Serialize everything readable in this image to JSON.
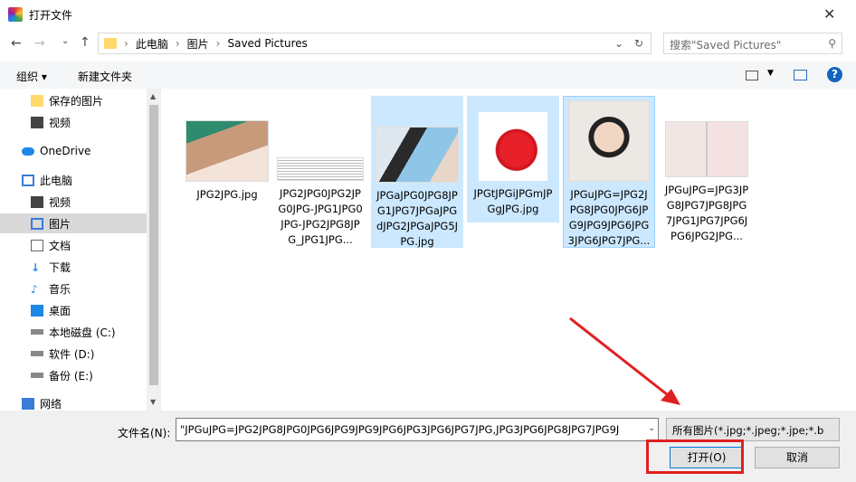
{
  "window": {
    "title": "打开文件"
  },
  "nav": {
    "breadcrumb": [
      "此电脑",
      "图片",
      "Saved Pictures"
    ],
    "search_placeholder": "搜索\"Saved Pictures\""
  },
  "toolbar": {
    "organize": "组织 ▾",
    "new_folder": "新建文件夹"
  },
  "sidebar": {
    "items": [
      {
        "label": "保存的图片",
        "icon": "folder-icon"
      },
      {
        "label": "视频",
        "icon": "video-icon"
      },
      {
        "label": "OneDrive",
        "icon": "cloud-icon"
      },
      {
        "label": "此电脑",
        "icon": "computer-icon"
      },
      {
        "label": "视频",
        "icon": "video-icon"
      },
      {
        "label": "图片",
        "icon": "pictures-icon",
        "selected": true
      },
      {
        "label": "文档",
        "icon": "document-icon"
      },
      {
        "label": "下载",
        "icon": "download-icon"
      },
      {
        "label": "音乐",
        "icon": "music-icon"
      },
      {
        "label": "桌面",
        "icon": "desktop-icon"
      },
      {
        "label": "本地磁盘 (C:)",
        "icon": "drive-icon"
      },
      {
        "label": "软件 (D:)",
        "icon": "drive-icon"
      },
      {
        "label": "备份 (E:)",
        "icon": "drive-icon"
      },
      {
        "label": "网络",
        "icon": "network-icon"
      }
    ]
  },
  "files": [
    {
      "name": "JPG2JPG.jpg",
      "selected": false
    },
    {
      "name": "JPG2JPG0JPG2JPG0JPG-JPG1JPG0JPG-JPG2JPG8JPG_JPG1JPG...",
      "selected": false
    },
    {
      "name": "JPGaJPG0JPG8JPG1JPG7JPGaJPGdJPG2JPGaJPG5JPG.jpg",
      "selected": true
    },
    {
      "name": "JPGtJPGiJPGmJPGgJPG.jpg",
      "selected": true
    },
    {
      "name": "JPGuJPG=JPG2JPG8JPG0JPG6JPG9JPG9JPG6JPG3JPG6JPG7JPG...",
      "selected": true
    },
    {
      "name": "JPGuJPG=JPG3JPG8JPG7JPG8JPG7JPG1JPG7JPG6JPG6JPG2JPG...",
      "selected": false
    }
  ],
  "bottom": {
    "filename_label": "文件名(N):",
    "filename_value": "\"JPGuJPG=JPG2JPG8JPG0JPG6JPG9JPG9JPG6JPG3JPG6JPG7JPG,JPG3JPG6JPG8JPG7JPG9J",
    "filter": "所有图片(*.jpg;*.jpeg;*.jpe;*.b",
    "open": "打开(O)",
    "cancel": "取消"
  }
}
